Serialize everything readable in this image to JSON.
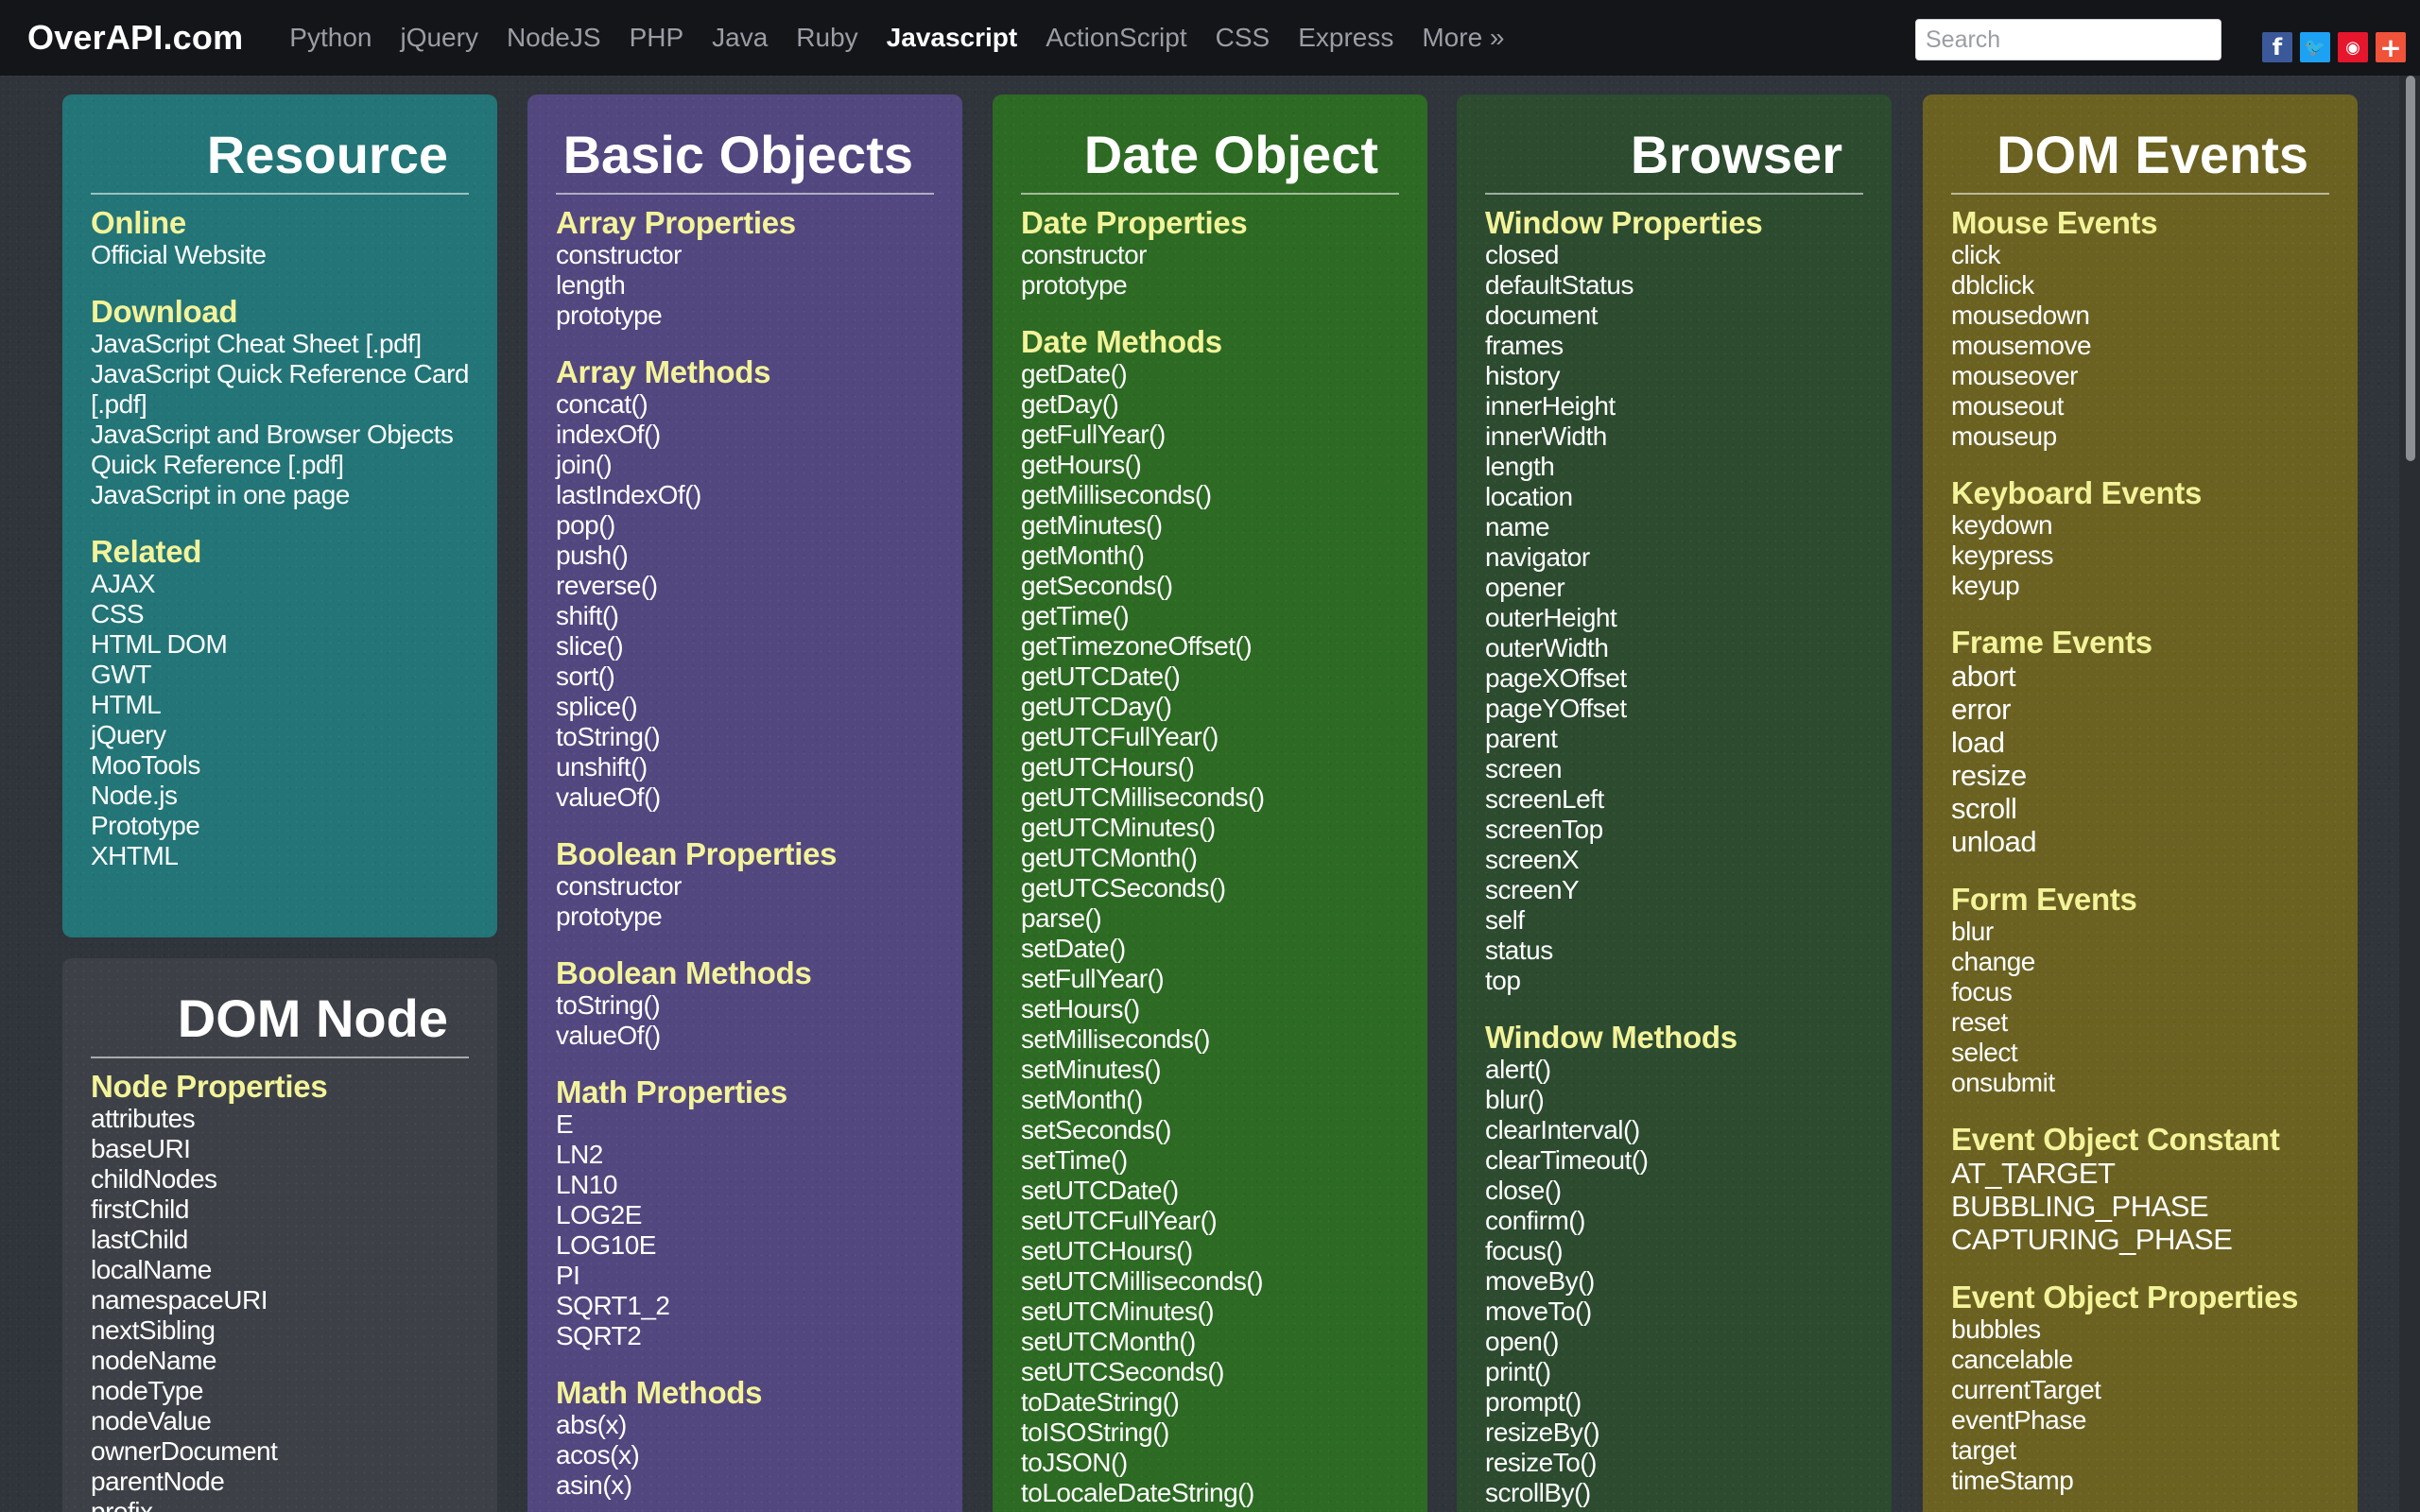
{
  "navbar": {
    "brand": "OverAPI.com",
    "items": [
      "Python",
      "jQuery",
      "NodeJS",
      "PHP",
      "Java",
      "Ruby",
      "Javascript",
      "ActionScript",
      "CSS",
      "Express",
      "More »"
    ],
    "active": "Javascript",
    "search_placeholder": "Search",
    "social": [
      {
        "icon": "facebook-icon",
        "glyph": "f"
      },
      {
        "icon": "twitter-icon",
        "glyph": "🐦"
      },
      {
        "icon": "weibo-icon",
        "glyph": "◉"
      },
      {
        "icon": "share-plus-icon",
        "glyph": "+"
      }
    ]
  },
  "columns": {
    "resource": {
      "title": "Resource",
      "sections": [
        {
          "title": "Online",
          "items": [
            "Official Website"
          ]
        },
        {
          "title": "Download",
          "items": [
            "JavaScript Cheat Sheet [.pdf]",
            "JavaScript Quick Reference Card [.pdf]",
            "JavaScript and Browser Objects Quick Reference [.pdf]",
            "JavaScript in one page"
          ]
        },
        {
          "title": "Related",
          "items": [
            "AJAX",
            "CSS",
            "HTML DOM",
            "GWT",
            "HTML",
            "jQuery",
            "MooTools",
            "Node.js",
            "Prototype",
            "XHTML"
          ]
        }
      ]
    },
    "domnode": {
      "title": "DOM Node",
      "sections": [
        {
          "title": "Node Properties",
          "items": [
            "attributes",
            "baseURI",
            "childNodes",
            "firstChild",
            "lastChild",
            "localName",
            "namespaceURI",
            "nextSibling",
            "nodeName",
            "nodeType",
            "nodeValue",
            "ownerDocument",
            "parentNode",
            "prefix"
          ]
        }
      ]
    },
    "basic": {
      "title": "Basic Objects",
      "sections": [
        {
          "title": "Array Properties",
          "items": [
            "constructor",
            "length",
            "prototype"
          ]
        },
        {
          "title": "Array Methods",
          "items": [
            "concat()",
            "indexOf()",
            "join()",
            "lastIndexOf()",
            "pop()",
            "push()",
            "reverse()",
            "shift()",
            "slice()",
            "sort()",
            "splice()",
            "toString()",
            "unshift()",
            "valueOf()"
          ]
        },
        {
          "title": "Boolean Properties",
          "items": [
            "constructor",
            "prototype"
          ]
        },
        {
          "title": "Boolean Methods",
          "items": [
            "toString()",
            "valueOf()"
          ]
        },
        {
          "title": "Math Properties",
          "items": [
            "E",
            "LN2",
            "LN10",
            "LOG2E",
            "LOG10E",
            "PI",
            "SQRT1_2",
            "SQRT2"
          ]
        },
        {
          "title": "Math Methods",
          "items": [
            "abs(x)",
            "acos(x)",
            "asin(x)"
          ]
        }
      ]
    },
    "date": {
      "title": "Date Object",
      "sections": [
        {
          "title": "Date Properties",
          "items": [
            "constructor",
            "prototype"
          ]
        },
        {
          "title": "Date Methods",
          "items": [
            "getDate()",
            "getDay()",
            "getFullYear()",
            "getHours()",
            "getMilliseconds()",
            "getMinutes()",
            "getMonth()",
            "getSeconds()",
            "getTime()",
            "getTimezoneOffset()",
            "getUTCDate()",
            "getUTCDay()",
            "getUTCFullYear()",
            "getUTCHours()",
            "getUTCMilliseconds()",
            "getUTCMinutes()",
            "getUTCMonth()",
            "getUTCSeconds()",
            "parse()",
            "setDate()",
            "setFullYear()",
            "setHours()",
            "setMilliseconds()",
            "setMinutes()",
            "setMonth()",
            "setSeconds()",
            "setTime()",
            "setUTCDate()",
            "setUTCFullYear()",
            "setUTCHours()",
            "setUTCMilliseconds()",
            "setUTCMinutes()",
            "setUTCMonth()",
            "setUTCSeconds()",
            "toDateString()",
            "toISOString()",
            "toJSON()",
            "toLocaleDateString()"
          ]
        }
      ]
    },
    "browser": {
      "title": "Browser",
      "sections": [
        {
          "title": "Window Properties",
          "items": [
            "closed",
            "defaultStatus",
            "document",
            "frames",
            "history",
            "innerHeight",
            "innerWidth",
            "length",
            "location",
            "name",
            "navigator",
            "opener",
            "outerHeight",
            "outerWidth",
            "pageXOffset",
            "pageYOffset",
            "parent",
            "screen",
            "screenLeft",
            "screenTop",
            "screenX",
            "screenY",
            "self",
            "status",
            "top"
          ]
        },
        {
          "title": "Window Methods",
          "items": [
            "alert()",
            "blur()",
            "clearInterval()",
            "clearTimeout()",
            "close()",
            "confirm()",
            "focus()",
            "moveBy()",
            "moveTo()",
            "open()",
            "print()",
            "prompt()",
            "resizeBy()",
            "resizeTo()",
            "scrollBy()"
          ]
        }
      ]
    },
    "dom": {
      "title": "DOM Events",
      "sections": [
        {
          "title": "Mouse Events",
          "items": [
            "click",
            "dblclick",
            "mousedown",
            "mousemove",
            "mouseover",
            "mouseout",
            "mouseup"
          ]
        },
        {
          "title": "Keyboard Events",
          "items": [
            "keydown",
            "keypress",
            "keyup"
          ]
        },
        {
          "title": "Frame Events",
          "items": [
            "abort",
            "error",
            "load",
            "resize",
            "scroll",
            "unload"
          ],
          "big": true
        },
        {
          "title": "Form Events",
          "items": [
            "blur",
            "change",
            "focus",
            "reset",
            "select",
            "onsubmit"
          ]
        },
        {
          "title": "Event Object Constant",
          "items": [
            "AT_TARGET",
            "BUBBLING_PHASE",
            "CAPTURING_PHASE"
          ],
          "big": true
        },
        {
          "title": "Event Object Properties",
          "items": [
            "bubbles",
            "cancelable",
            "currentTarget",
            "eventPhase",
            "target",
            "timeStamp"
          ]
        }
      ]
    }
  },
  "colors": {
    "resource": "#237577",
    "domnode": "#3d4147",
    "basic": "#53477f",
    "date": "#2d6a23",
    "browser": "#2c4b2f",
    "dom": "#6b6222",
    "section_title": "#f3f39a"
  }
}
